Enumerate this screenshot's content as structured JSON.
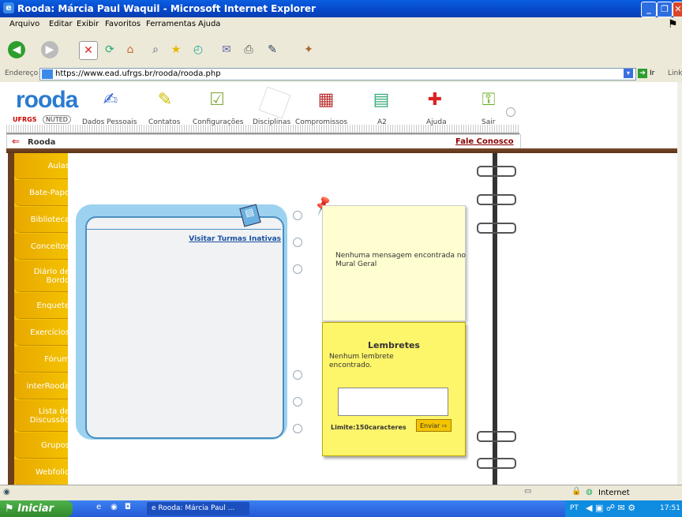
{
  "window": {
    "title": "Rooda: Márcia Paul Waquil - Microsoft Internet Explorer"
  },
  "menu": [
    "Arquivo",
    "Editar",
    "Exibir",
    "Favoritos",
    "Ferramentas",
    "Ajuda"
  ],
  "address": {
    "label": "Endereço",
    "url": "https://www.ead.ufrgs.br/rooda/rooda.php",
    "go_label": "Ir",
    "links_label": "Link"
  },
  "brand": {
    "logo": "rooda",
    "ufrgs": "UFRGS",
    "nuted": "NUTED"
  },
  "topnav": [
    "Dados Pessoais",
    "Contatos",
    "Configurações",
    "Disciplinas",
    "Compromissos",
    "A2",
    "Ajuda",
    "Sair"
  ],
  "breadcrumb": {
    "home": "Rooda",
    "contact": "Fale Conosco"
  },
  "sidetabs": [
    "Aulas",
    "Bate-Papo",
    "Biblioteca",
    "Conceitos",
    "Diário de Bordo",
    "Enquete",
    "Exercícios",
    "Fórum",
    "interRooda",
    "Lista de Discussão",
    "Grupos",
    "Webfolio"
  ],
  "card": {
    "link": "Visitar Turmas Inativas"
  },
  "mural": {
    "message": "Nenhuma mensagem encontrada no Mural Geral"
  },
  "lembretes": {
    "title": "Lembretes",
    "message": "Nenhum lembrete encontrado.",
    "limit": "Limite:150caracteres",
    "send": "Enviar"
  },
  "status": {
    "zone": "Internet"
  },
  "taskbar": {
    "start": "Iniciar",
    "task": "Rooda: Márcia Paul ...",
    "lang": "PT",
    "time": "17:51"
  }
}
